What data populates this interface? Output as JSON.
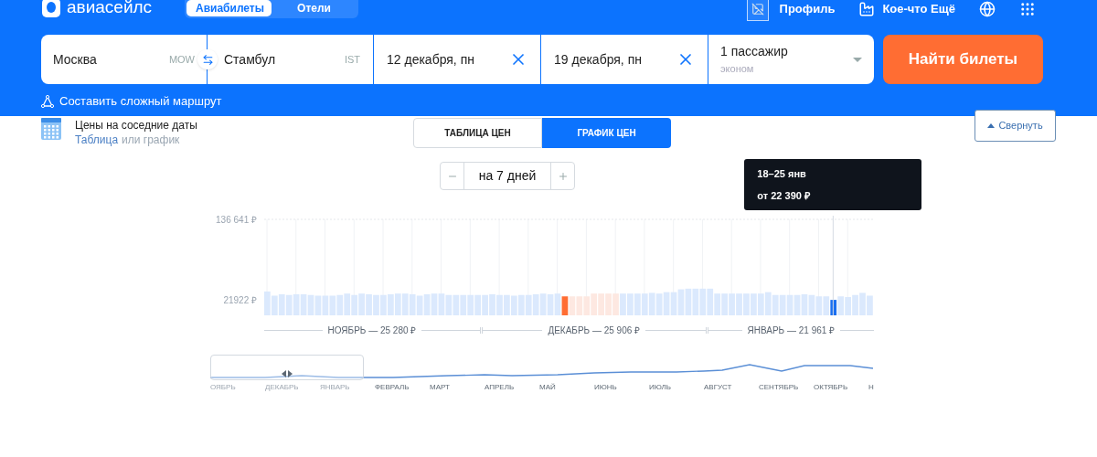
{
  "header": {
    "logo": "авиасейлс",
    "tabs": [
      {
        "label": "Авиабилеты",
        "selected": true
      },
      {
        "label": "Отели",
        "selected": false
      }
    ],
    "nav": [
      {
        "kind": "profile",
        "label": "Профиль"
      },
      {
        "kind": "more",
        "label": "Кое-что Ещё"
      },
      {
        "kind": "language"
      },
      {
        "kind": "apps"
      }
    ]
  },
  "search": {
    "origin": {
      "value": "Москва",
      "code": "MOW"
    },
    "destination": {
      "value": "Стамбул",
      "code": "IST"
    },
    "dates": [
      {
        "value": "12 декабря, пн"
      },
      {
        "value": "19 декабря, пн"
      }
    ],
    "passengers": {
      "value": "1 пассажир",
      "cabin": "эконом"
    },
    "submit": "Найти билеты",
    "complex_route": "Составить сложный маршрут"
  },
  "prices": {
    "title": "Цены на соседние даты",
    "subtitle_link": "Таблица",
    "subtitle_rest": "или график",
    "view_tabs": [
      {
        "label": "ТАБЛИЦА ЦЕН",
        "selected": false
      },
      {
        "label": "ГРАФИК ЦЕН",
        "selected": true
      }
    ],
    "collapse": "Свернуть",
    "stepper": {
      "value": "на 7 дней"
    },
    "tooltip": {
      "dates": "18–25 янв",
      "price": "от 22 390 ₽"
    },
    "chart_data": {
      "type": "bar",
      "ylim": [
        0,
        136641
      ],
      "yticks": [
        {
          "value": 21922,
          "label": "21922 ₽"
        },
        {
          "value": 136641,
          "label": "136 641 ₽"
        }
      ],
      "grid": true,
      "series": [
        {
          "color": "#dbe9fd",
          "values": [
            34000,
            28000,
            30000,
            29000,
            30000,
            30000,
            29000,
            28000,
            28000,
            28000,
            29000,
            31000,
            29000,
            31000,
            30000,
            29000,
            29000,
            30000,
            31000,
            31000,
            30000,
            28000,
            30000,
            31000,
            31000,
            29000,
            29000,
            29000,
            29000,
            29000,
            29000,
            30000,
            29000,
            29000,
            28000,
            29000,
            29000,
            30000,
            31000,
            30000,
            31000,
            null,
            null,
            null,
            null,
            null,
            null,
            null,
            null,
            31000,
            31000,
            31000,
            31000,
            32000,
            31000,
            33000,
            33000,
            37000,
            38000,
            38000,
            38000,
            38000,
            31000,
            31000,
            31000,
            31000,
            31000,
            31000,
            31000,
            33000,
            29000,
            29000,
            29000,
            29000,
            30000,
            29000,
            27000,
            27000,
            null,
            27000,
            26000,
            29000,
            32000,
            28000
          ]
        },
        {
          "color": "#ff6d33",
          "values": [
            null,
            null,
            null,
            null,
            null,
            null,
            null,
            null,
            null,
            null,
            null,
            null,
            null,
            null,
            null,
            null,
            null,
            null,
            null,
            null,
            null,
            null,
            null,
            null,
            null,
            null,
            null,
            null,
            null,
            null,
            null,
            null,
            null,
            null,
            null,
            null,
            null,
            null,
            null,
            null,
            null,
            27000,
            null,
            null,
            null,
            null,
            null,
            null,
            null,
            null,
            null,
            null,
            null,
            null,
            null,
            null,
            null,
            null,
            null,
            null,
            null,
            null,
            null,
            null,
            null,
            null,
            null,
            null,
            null,
            null,
            null,
            null,
            null,
            null,
            null,
            null,
            null,
            null,
            null,
            null,
            null,
            null,
            null,
            null
          ]
        },
        {
          "color": "#fde8e1",
          "values": [
            null,
            null,
            null,
            null,
            null,
            null,
            null,
            null,
            null,
            null,
            null,
            null,
            null,
            null,
            null,
            null,
            null,
            null,
            null,
            null,
            null,
            null,
            null,
            null,
            null,
            null,
            null,
            null,
            null,
            null,
            null,
            null,
            null,
            null,
            null,
            null,
            null,
            null,
            null,
            null,
            null,
            null,
            27000,
            27000,
            27000,
            31000,
            31000,
            31000,
            31000,
            null,
            null,
            null,
            null,
            null,
            null,
            null,
            null,
            null,
            null,
            null,
            null,
            null,
            null,
            null,
            null,
            null,
            null,
            null,
            null,
            null,
            null,
            null,
            null,
            null,
            null,
            null,
            null,
            null,
            null,
            null,
            null,
            null,
            null,
            null
          ]
        },
        {
          "color": "#1a6ff0",
          "values": [
            null,
            null,
            null,
            null,
            null,
            null,
            null,
            null,
            null,
            null,
            null,
            null,
            null,
            null,
            null,
            null,
            null,
            null,
            null,
            null,
            null,
            null,
            null,
            null,
            null,
            null,
            null,
            null,
            null,
            null,
            null,
            null,
            null,
            null,
            null,
            null,
            null,
            null,
            null,
            null,
            null,
            null,
            null,
            null,
            null,
            null,
            null,
            null,
            null,
            null,
            null,
            null,
            null,
            null,
            null,
            null,
            null,
            null,
            null,
            null,
            null,
            null,
            null,
            null,
            null,
            null,
            null,
            null,
            null,
            null,
            null,
            null,
            null,
            null,
            null,
            null,
            null,
            null,
            22000,
            null,
            null,
            null,
            null,
            null
          ]
        }
      ]
    },
    "months": [
      {
        "label": "НОЯБРЬ — 25 280 ₽"
      },
      {
        "label": "ДЕКАБРЬ — 25 906 ₽"
      },
      {
        "label": "ЯНВАРЬ — 21 961 ₽"
      }
    ],
    "overview_months": [
      {
        "label": "ОЯБРЬ",
        "in_window": true
      },
      {
        "label": "ДЕКАБРЬ",
        "in_window": true
      },
      {
        "label": "ЯНВАРЬ",
        "in_window": true
      },
      {
        "label": "ФЕВРАЛЬ",
        "in_window": false
      },
      {
        "label": "МАРТ",
        "in_window": false
      },
      {
        "label": "АПРЕЛЬ",
        "in_window": false
      },
      {
        "label": "МАЙ",
        "in_window": false
      },
      {
        "label": "ИЮНЬ",
        "in_window": false
      },
      {
        "label": "ИЮЛЬ",
        "in_window": false
      },
      {
        "label": "АВГУСТ",
        "in_window": false
      },
      {
        "label": "СЕНТЯБРЬ",
        "in_window": false
      },
      {
        "label": "ОКТЯБРЬ",
        "in_window": false
      },
      {
        "label": "Н",
        "in_window": false
      }
    ]
  }
}
